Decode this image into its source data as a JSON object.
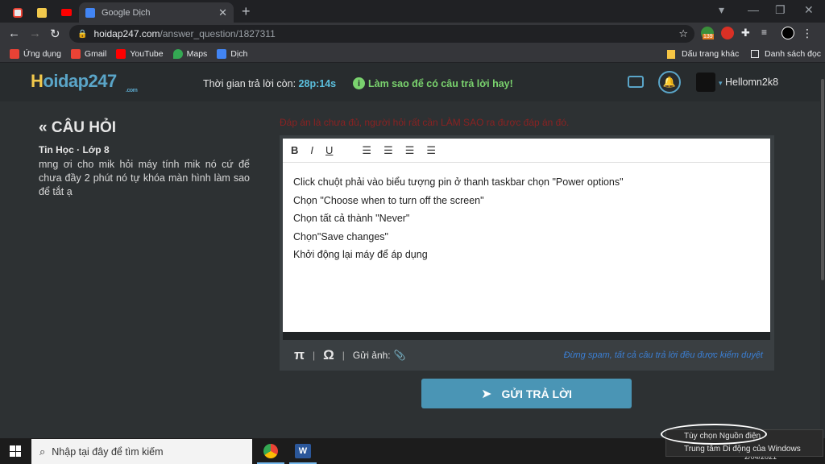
{
  "browser": {
    "tabs": [
      {
        "title": "Google Dịch",
        "active": true
      }
    ],
    "new_tab": "+",
    "url_domain": "hoidap247.com",
    "url_path": "/answer_question/1827311",
    "bookmarks": [
      {
        "label": "Ứng dụng",
        "color": "#e94235"
      },
      {
        "label": "Gmail",
        "color": "#ea4335"
      },
      {
        "label": "YouTube",
        "color": "#ff0000"
      },
      {
        "label": "Maps",
        "color": "#34a853"
      },
      {
        "label": "Dịch",
        "color": "#4285f4"
      }
    ],
    "bookmark_other": "Dấu trang khác",
    "reading_list": "Danh sách đọc",
    "extension_badge": "139"
  },
  "site": {
    "logo": "Hoidap247",
    "logo_h": "H",
    "logo_rest": "oidap247",
    "logo_suffix": ".com",
    "timer_label": "Thời gian trả lời còn:",
    "timer_value": "28p:14s",
    "tips_label": "Làm sao để có câu trả lời hay!",
    "username": "Hellomn2k8"
  },
  "question": {
    "heading": "« CÂU HỎI",
    "subject": "Tin Học · Lớp 8",
    "body": "mng ơi cho mik hỏi máy tính mik  nó cứ để chưa đầy 2 phút nó tự khóa màn hình làm sao để tắt ạ"
  },
  "answer": {
    "warning": "Đáp án là chưa đủ, người hỏi rất cần LÀM SAO ra được đáp án đó.",
    "toolbar": [
      "B",
      "I",
      "U"
    ],
    "lines": [
      "Click chuột phải vào biểu tượng pin ở thanh taskbar chọn \"Power options\"",
      "Chọn \"Choose when to turn off the screen\"",
      "Chọn tất cả thành \"Never\"",
      "Chọn\"Save changes\"",
      "Khởi động lại máy để áp dụng"
    ],
    "footer_pi": "π",
    "footer_omega": "Ω",
    "footer_image": "Gửi ảnh:",
    "footer_note": "Đừng spam, tất cả câu trả lời đều được kiểm duyệt",
    "submit": "GỬI TRẢ LỜI"
  },
  "context_menu": {
    "items": [
      "Tùy chọn Nguồn điện",
      "Trung tâm Di động của Windows"
    ]
  },
  "taskbar": {
    "search_placeholder": "Nhập tại đây để tìm kiếm",
    "clock": "2/04/2021"
  }
}
